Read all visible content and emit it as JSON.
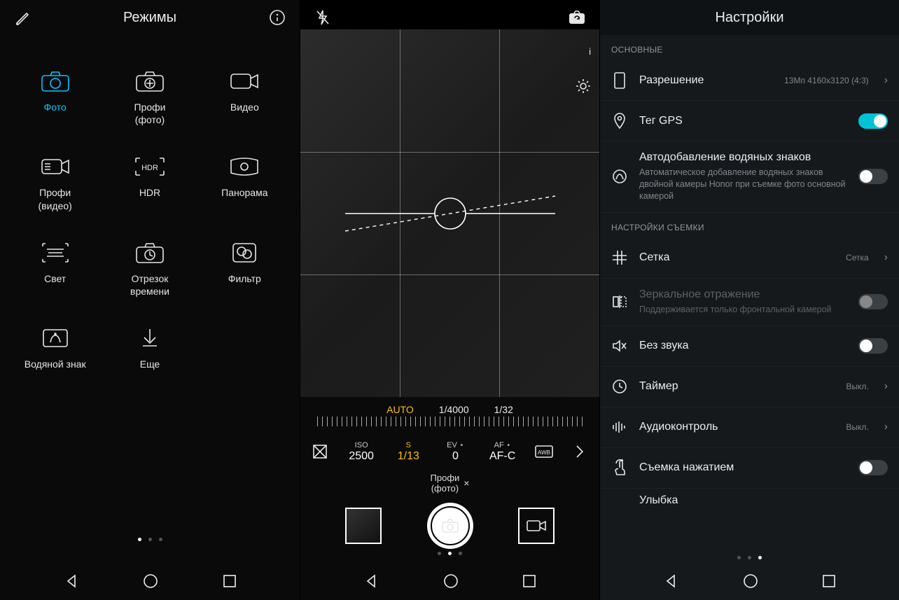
{
  "panel1": {
    "title": "Режимы",
    "modes": [
      {
        "label": "Фото",
        "active": true,
        "icon": "camera"
      },
      {
        "label": "Профи\n(фото)",
        "icon": "camera-pro"
      },
      {
        "label": "Видео",
        "icon": "video"
      },
      {
        "label": "Профи\n(видео)",
        "icon": "video-pro"
      },
      {
        "label": "HDR",
        "icon": "hdr"
      },
      {
        "label": "Панорама",
        "icon": "panorama"
      },
      {
        "label": "Свет",
        "icon": "light"
      },
      {
        "label": "Отрезок\nвремени",
        "icon": "timelapse"
      },
      {
        "label": "Фильтр",
        "icon": "filter"
      },
      {
        "label": "Водяной знак",
        "icon": "watermark"
      },
      {
        "label": "Еще",
        "icon": "download"
      }
    ],
    "pager": {
      "count": 3,
      "active": 0
    }
  },
  "panel2": {
    "readout": {
      "auto": "AUTO",
      "shutter": "1/4000",
      "aperture": "1/32"
    },
    "pro": {
      "iso": {
        "label": "ISO",
        "value": "2500"
      },
      "s": {
        "label": "S",
        "value": "1/13"
      },
      "ev": {
        "label": "EV ⋆",
        "value": "0"
      },
      "af": {
        "label": "AF ⋆",
        "value": "AF-C"
      }
    },
    "mode_label": "Профи\n(фото)",
    "pager": {
      "count": 3,
      "active": 1
    },
    "indicator": "i"
  },
  "panel3": {
    "title": "Настройки",
    "section1": "ОСНОВНЫЕ",
    "resolution": {
      "title": "Разрешение",
      "value": "13Мп 4160x3120 (4:3)"
    },
    "gps": {
      "title": "Тег GPS",
      "on": true
    },
    "watermark": {
      "title": "Автодобавление водяных знаков",
      "sub": "Автоматическое добавление водяных знаков двойной камеры Honor при съемке фото основной камерой",
      "on": false
    },
    "section2": "НАСТРОЙКИ СЪЕМКИ",
    "grid": {
      "title": "Сетка",
      "value": "Сетка"
    },
    "mirror": {
      "title": "Зеркальное отражение",
      "sub": "Поддерживается только фронтальной камерой"
    },
    "mute": {
      "title": "Без звука",
      "on": false
    },
    "timer": {
      "title": "Таймер",
      "value": "Выкл."
    },
    "audio": {
      "title": "Аудиоконтроль",
      "value": "Выкл."
    },
    "touch": {
      "title": "Съемка нажатием",
      "on": false
    },
    "smile": {
      "title": "Улыбка"
    },
    "pager": {
      "count": 3,
      "active": 2
    }
  }
}
